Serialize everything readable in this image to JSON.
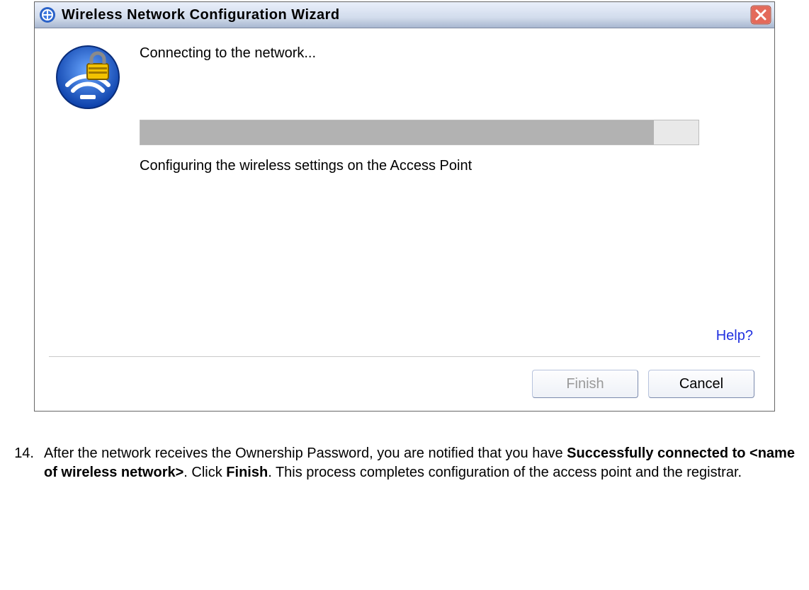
{
  "window": {
    "title": "Wireless Network Configuration Wizard",
    "heading": "Connecting to the network...",
    "status": "Configuring the wireless settings on the Access Point",
    "help_label": "Help?",
    "finish_label": "Finish",
    "cancel_label": "Cancel",
    "progress_percent": 92
  },
  "instruction": {
    "number": "14.",
    "text_before": "After the network receives the Ownership Password, you are notified that you have ",
    "bold1": "Successfully connected to <name of wireless network>",
    "text_mid": ". Click ",
    "bold2": "Finish",
    "text_after": ". This process completes configuration of the access point and the registrar."
  }
}
